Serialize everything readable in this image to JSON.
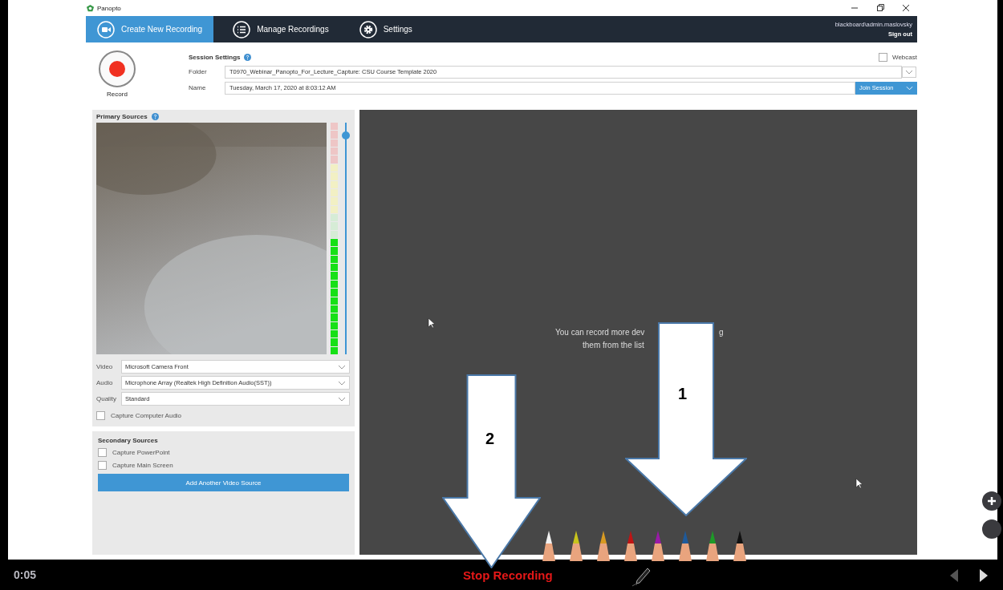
{
  "window": {
    "app_name": "Panopto",
    "user": "blackboard\\admin.maslovsky",
    "sign_out": "Sign out"
  },
  "tabs": [
    {
      "label": "Create New Recording",
      "kind": "camera",
      "selected": true
    },
    {
      "label": "Manage Recordings",
      "kind": "list",
      "selected": false
    },
    {
      "label": "Settings",
      "kind": "gear",
      "selected": false
    }
  ],
  "record": {
    "label": "Record"
  },
  "session_settings": {
    "title": "Session Settings",
    "webcast": {
      "label": "Webcast",
      "checked": false
    },
    "folder": {
      "label": "Folder",
      "value": "T0970_Webinar_Panopto_For_Lecture_Capture: CSU Course Template 2020"
    },
    "name": {
      "label": "Name",
      "value": "Tuesday, March 17, 2020 at 8:03:12 AM"
    },
    "join_button": "Join Session"
  },
  "primary_sources": {
    "title": "Primary Sources",
    "audio_meter": {
      "level": 0.5
    },
    "volume_slider": {
      "level": 0.96
    },
    "selects": [
      {
        "label": "Video",
        "value": "Microsoft Camera Front"
      },
      {
        "label": "Audio",
        "value": "Microphone Array (Realtek High Definition Audio(SST))"
      },
      {
        "label": "Quality",
        "value": "Standard"
      }
    ],
    "capture_audio": {
      "label": "Capture Computer Audio",
      "checked": false
    }
  },
  "secondary_sources": {
    "title": "Secondary Sources",
    "options": [
      {
        "label": "Capture PowerPoint",
        "checked": false
      },
      {
        "label": "Capture Main Screen",
        "checked": false
      }
    ],
    "add_button": "Add Another Video Source"
  },
  "canvas": {
    "line_1_start": "You can record more dev",
    "line_1_end": "g",
    "line_2": "them from the list"
  },
  "annotations": [
    {
      "label": "1"
    },
    {
      "label": "2"
    }
  ],
  "pen_colors": [
    {
      "color": "#f2f2f2"
    },
    {
      "color": "#c8c41c"
    },
    {
      "color": "#d89a22"
    },
    {
      "color": "#c01414"
    },
    {
      "color": "#9a1aa8"
    },
    {
      "color": "#1f5a9a"
    },
    {
      "color": "#1e9a28"
    },
    {
      "color": "#111111"
    }
  ],
  "player": {
    "time": "0:05",
    "stop": "Stop Recording",
    "prev": {
      "disabled": true
    },
    "next": {
      "disabled": false
    }
  }
}
